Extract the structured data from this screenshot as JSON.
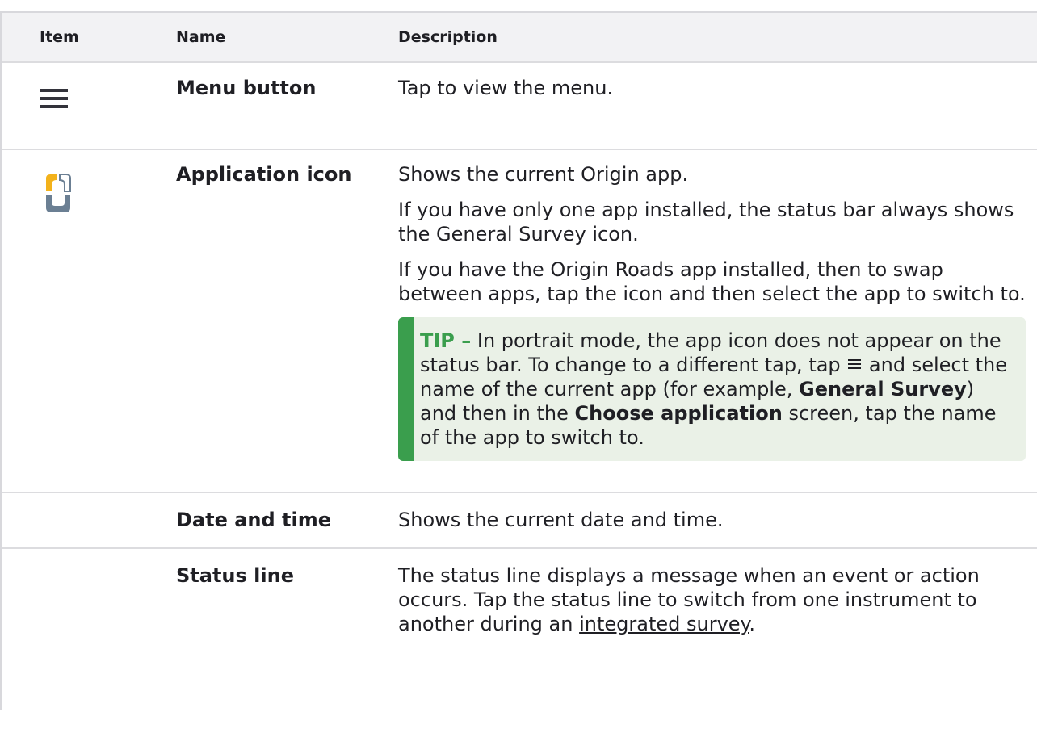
{
  "table": {
    "headers": {
      "item": "Item",
      "name": "Name",
      "description": "Description"
    },
    "rows": [
      {
        "icon": "hamburger-menu-icon",
        "name": "Menu button",
        "description": [
          "Tap to view the menu."
        ]
      },
      {
        "icon": "origin-application-icon",
        "name": "Application icon",
        "description": [
          "Shows the current Origin app.",
          "If you have only one app installed, the status bar always shows the General Survey icon.",
          "If you have the Origin Roads app installed, then to swap between apps, tap the icon and then select the app to switch to."
        ],
        "tip": {
          "label": "TIP –",
          "text_1": " In portrait mode, the app icon does not appear on the status bar. To change to a different tap, tap ",
          "text_2": " and select the name of the current app (for example, ",
          "bold_1": "General Survey",
          "text_3": ") and then in the ",
          "bold_2": "Choose application",
          "text_4": " screen, tap the name of the app to switch to."
        }
      },
      {
        "icon": "",
        "name": "Date and time",
        "description": [
          "Shows the current date and time."
        ]
      },
      {
        "icon": "",
        "name": "Status line",
        "description_prefix": "The status line displays a message when an event or action occurs. Tap the status line to switch from one instrument to another during an ",
        "description_link": "integrated survey",
        "description_suffix": "."
      }
    ]
  },
  "colors": {
    "tip_accent": "#3a9e4d",
    "tip_background": "#eaf1e7",
    "header_background": "#f2f2f4",
    "icon_orange": "#f3b21b",
    "icon_blue_gray": "#6b7f93"
  }
}
